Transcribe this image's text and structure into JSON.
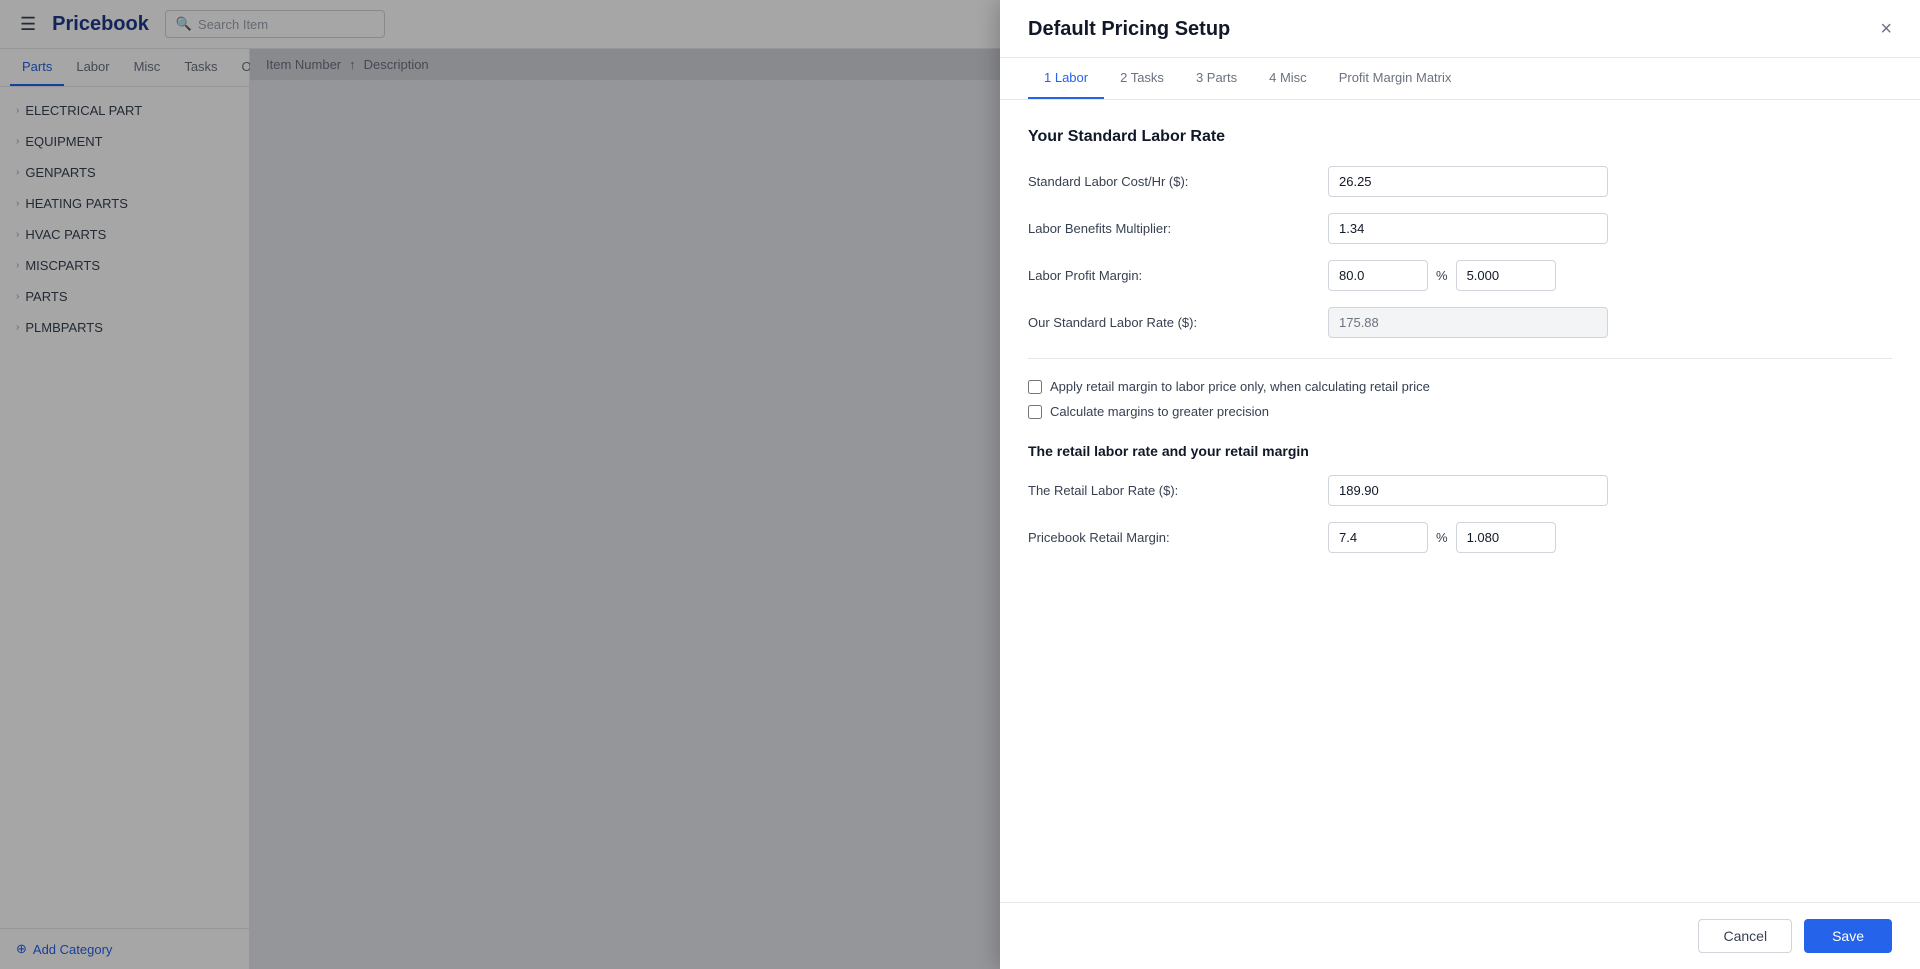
{
  "app": {
    "title": "Pricebook",
    "search_placeholder": "Search Item"
  },
  "sidebar_tabs": [
    {
      "label": "Parts",
      "active": true
    },
    {
      "label": "Labor"
    },
    {
      "label": "Misc"
    },
    {
      "label": "Tasks"
    },
    {
      "label": "Overhead"
    }
  ],
  "sidebar_items": [
    {
      "label": "ELECTRICAL PART"
    },
    {
      "label": "EQUIPMENT"
    },
    {
      "label": "GENPARTS"
    },
    {
      "label": "HEATING PARTS"
    },
    {
      "label": "HVAC PARTS"
    },
    {
      "label": "MISCPARTS"
    },
    {
      "label": "PARTS"
    },
    {
      "label": "PLMBPARTS"
    }
  ],
  "add_category_label": "Add Category",
  "content_header": {
    "item_number_label": "Item Number",
    "description_label": "Description"
  },
  "modal": {
    "title": "Default Pricing Setup",
    "close_label": "×",
    "tabs": [
      {
        "label": "1 Labor",
        "active": true
      },
      {
        "label": "2 Tasks"
      },
      {
        "label": "3 Parts"
      },
      {
        "label": "4 Misc"
      },
      {
        "label": "Profit Margin Matrix"
      }
    ],
    "section_title": "Your Standard Labor Rate",
    "fields": {
      "standard_labor_cost_label": "Standard Labor Cost/Hr ($):",
      "standard_labor_cost_value": "26.25",
      "labor_benefits_label": "Labor Benefits Multiplier:",
      "labor_benefits_value": "1.34",
      "labor_profit_margin_label": "Labor Profit Margin:",
      "labor_profit_margin_percent": "80.0",
      "labor_profit_margin_multiplier": "5.000",
      "percent_sign": "%",
      "standard_labor_rate_label": "Our Standard Labor Rate ($):",
      "standard_labor_rate_value": "175.88"
    },
    "checkboxes": [
      {
        "label": "Apply retail margin to labor price only, when calculating retail price",
        "checked": false
      },
      {
        "label": "Calculate margins to greater precision",
        "checked": false
      }
    ],
    "subsection_title": "The retail labor rate and your retail margin",
    "retail_fields": {
      "retail_labor_rate_label": "The Retail Labor Rate ($):",
      "retail_labor_rate_value": "189.90",
      "pricebook_retail_margin_label": "Pricebook Retail Margin:",
      "pricebook_retail_margin_percent": "7.4",
      "pricebook_retail_margin_multiplier": "1.080",
      "percent_sign": "%"
    },
    "footer": {
      "cancel_label": "Cancel",
      "save_label": "Save"
    }
  }
}
